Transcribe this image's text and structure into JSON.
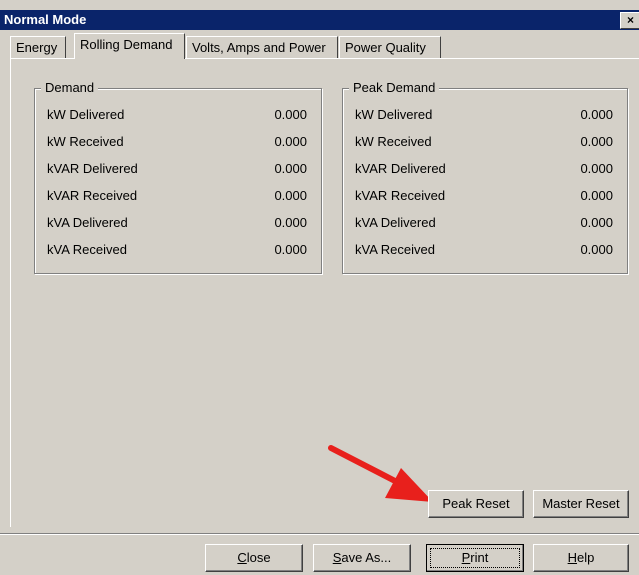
{
  "window": {
    "title": "Normal Mode",
    "close_glyph": "×"
  },
  "tabs": [
    {
      "label": "Energy"
    },
    {
      "label": "Rolling Demand",
      "active": true
    },
    {
      "label": "Volts, Amps and Power"
    },
    {
      "label": "Power Quality"
    }
  ],
  "demand": {
    "title": "Demand",
    "rows": [
      {
        "label": "kW Delivered",
        "value": "0.000"
      },
      {
        "label": "kW Received",
        "value": "0.000"
      },
      {
        "label": "kVAR Delivered",
        "value": "0.000"
      },
      {
        "label": "kVAR Received",
        "value": "0.000"
      },
      {
        "label": "kVA Delivered",
        "value": "0.000"
      },
      {
        "label": "kVA Received",
        "value": "0.000"
      }
    ]
  },
  "peak_demand": {
    "title": "Peak Demand",
    "rows": [
      {
        "label": "kW Delivered",
        "value": "0.000"
      },
      {
        "label": "kW Received",
        "value": "0.000"
      },
      {
        "label": "kVAR Delivered",
        "value": "0.000"
      },
      {
        "label": "kVAR Received",
        "value": "0.000"
      },
      {
        "label": "kVA Delivered",
        "value": "0.000"
      },
      {
        "label": "kVA Received",
        "value": "0.000"
      }
    ]
  },
  "actions": {
    "peak_reset": "Peak Reset",
    "master_reset": "Master Reset"
  },
  "footer": {
    "close_rest": "lose",
    "close_key": "C",
    "save_rest": "ave As...",
    "save_key": "S",
    "print_rest": "rint",
    "print_key": "P",
    "help_rest": "elp",
    "help_key": "H"
  },
  "annotation": {
    "arrow_color": "#e8201c"
  }
}
